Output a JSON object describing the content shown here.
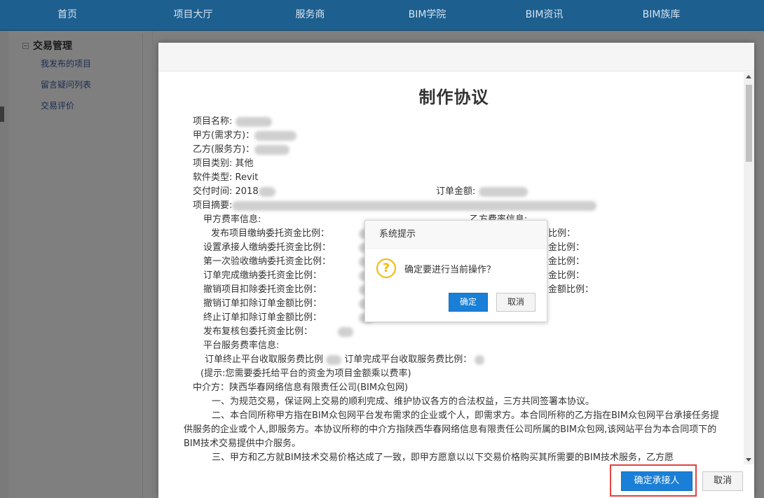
{
  "nav": [
    "首页",
    "项目大厅",
    "服务商",
    "BIM学院",
    "BIM资讯",
    "BIM族库"
  ],
  "sidebar": {
    "group": "交易管理",
    "items": [
      "我发布的项目",
      "留言疑问列表",
      "交易评价"
    ]
  },
  "agreement": {
    "title": "制作协议",
    "fields": {
      "project_name": "项目名称:",
      "party_a": "甲方(需求方)：",
      "party_b": "乙方(服务方)：",
      "category": "项目类别: 其他",
      "software": "软件类型: Revit",
      "delivery": "交付时间: 2018",
      "order_amount": "订单金额:",
      "summary": "项目摘要:"
    },
    "party_a_fees_label": "甲方费率信息:",
    "party_b_fees_label": "乙方费率信息:",
    "fee_rows": [
      {
        "left": "发布项目缴纳委托资金比例：",
        "right": "比例："
      },
      {
        "left": "设置承接人缴纳委托资金比例：",
        "right": "金比例："
      },
      {
        "left": "第一次验收缴纳委托资金比例：",
        "right": "金比例："
      },
      {
        "left": "订单完成缴纳委托资金比例：",
        "right": "金比例："
      },
      {
        "left": "撤销项目扣除委托资金比例：",
        "right": "金额比例："
      },
      {
        "left": "撤销订单扣除订单金额比例：",
        "right": ""
      },
      {
        "left": "终止订单扣除订单金额比例：",
        "right": ""
      },
      {
        "left": "发布复核包委托资金比例：",
        "right": ""
      }
    ],
    "platform_fee_label": "平台服务费率信息:",
    "platform_fee_line": "订单终止平台收取服务费比例",
    "platform_fee_line2": "订单完成平台收取服务费比例：",
    "tip": "(提示:您需要委托给平台的资金为项目金额乘以费率)",
    "intermediary": "中介方：陕西华春网络信息有限责任公司(BIM众包网)",
    "clause1": "一、为规范交易，保证网上交易的顺利完成、维护协议各方的合法权益，三方共同签署本协议。",
    "clause2": "二、本合同所称甲方指在BIM众包网平台发布需求的企业或个人，即需求方。本合同所称的乙方指在BIM众包网平台承接任务提供服务的企业或个人,即服务方。本协议所称的中介方指陕西华春网络信息有限责任公司所属的BIM众包网,该网站平台为本合同项下的BIM技术交易提供中介服务。",
    "clause3": "三、甲方和乙方就BIM技术交易价格达成了一致，即甲方愿意以以下交易价格购买其所需要的BIM技术服务，乙方愿",
    "confirm_assign_label": "确定承接人",
    "cancel_label": "取消"
  },
  "dialog": {
    "title": "系统提示",
    "message": "确定要进行当前操作？",
    "ok_label": "确定",
    "cancel_label": "取消",
    "icon": "question-icon"
  },
  "colors": {
    "nav_bg": "#1d5f8f",
    "primary_button": "#1a7fd6",
    "highlight": "#e24242",
    "warning_icon": "#f5b800"
  }
}
